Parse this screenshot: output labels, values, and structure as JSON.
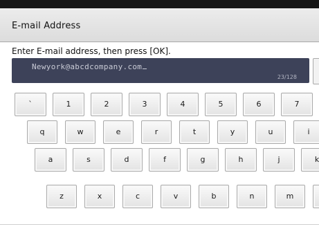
{
  "window": {
    "title": "E-mail Address"
  },
  "instruction": "Enter E-mail address, then press [OK].",
  "input": {
    "value": "Newyork@abcdcompany.com",
    "char_count": "23/128"
  },
  "keyboard": {
    "row1": [
      "`",
      "1",
      "2",
      "3",
      "4",
      "5",
      "6",
      "7"
    ],
    "row2": [
      "q",
      "w",
      "e",
      "r",
      "t",
      "y",
      "u",
      "i"
    ],
    "row3": [
      "a",
      "s",
      "d",
      "f",
      "g",
      "h",
      "j",
      "k"
    ],
    "row4": [
      "z",
      "x",
      "c",
      "v",
      "b",
      "n",
      "m",
      ""
    ]
  },
  "colors": {
    "input_background": "#3d4259",
    "input_text": "#c9cbd6",
    "bezel": "#161616"
  }
}
